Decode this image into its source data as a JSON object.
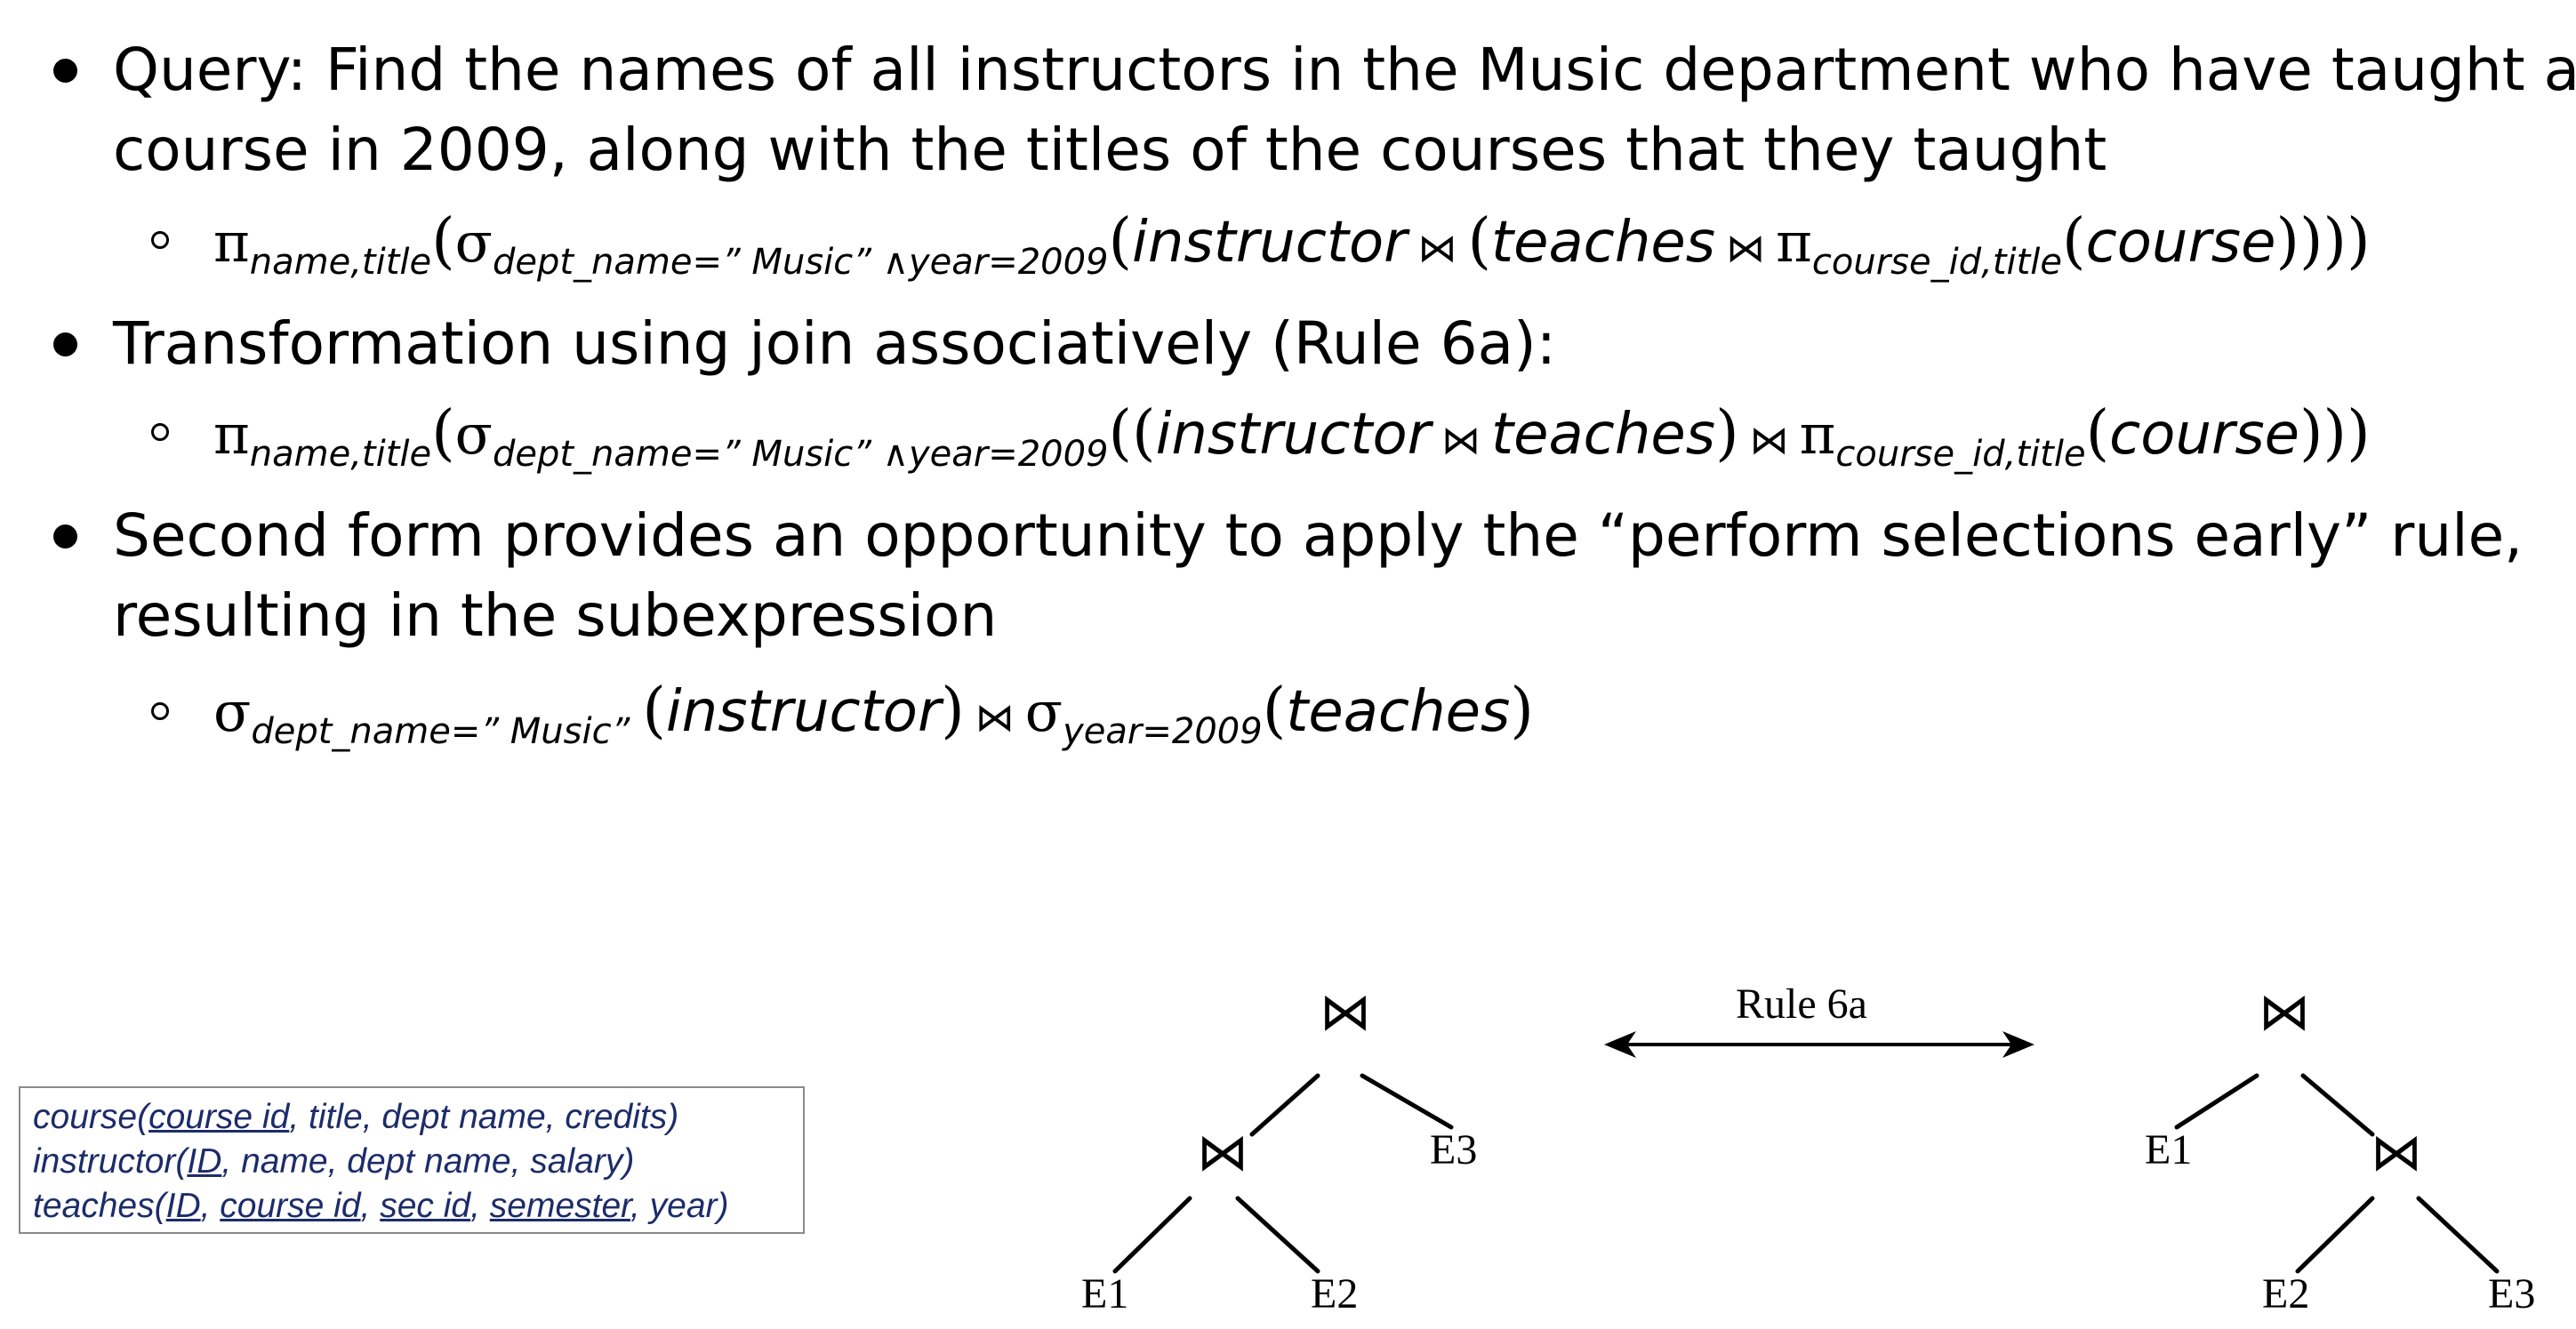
{
  "bullets": [
    {
      "lines": [
        "Query: Find the names of all instructors in the Music department who have taught a",
        "course in 2009, along with the titles of the courses that they taught"
      ]
    },
    {
      "lines": [
        "Transformation using join associatively (Rule 6a):"
      ]
    },
    {
      "lines": [
        "Second form provides an opportunity to apply the “perform selections early” rule,",
        "resulting in the subexpression"
      ]
    }
  ],
  "formulas": {
    "f1": {
      "pi": "π",
      "pi_sub": "name,title",
      "sigma": "σ",
      "sigma_sub": "dept_name=” Music” ∧year=2009",
      "rel_instructor": "instructor",
      "join": "⋈",
      "rel_teaches": "teaches",
      "pi2": "π",
      "pi2_sub": "course_id,title",
      "rel_course": "course"
    },
    "f2": {
      "pi": "π",
      "pi_sub": "name,title",
      "sigma": "σ",
      "sigma_sub": "dept_name=” Music” ∧year=2009",
      "rel_instructor": "instructor",
      "join": "⋈",
      "rel_teaches": "teaches",
      "pi2": "π",
      "pi2_sub": "course_id,title",
      "rel_course": "course"
    },
    "f3": {
      "sigma": "σ",
      "sigma_sub": "dept_name=” Music”",
      "rel_instructor": "instructor",
      "join": "⋈",
      "sigma2": "σ",
      "sigma2_sub": "year=2009",
      "rel_teaches": "teaches"
    }
  },
  "schema": {
    "course": {
      "name": "course",
      "attrs": [
        {
          "text": "course id",
          "key": true
        },
        {
          "text": "title",
          "key": false
        },
        {
          "text": "dept name",
          "key": false
        },
        {
          "text": "credits",
          "key": false
        }
      ]
    },
    "instructor": {
      "name": "instructor",
      "attrs": [
        {
          "text": "ID",
          "key": true
        },
        {
          "text": "name",
          "key": false
        },
        {
          "text": "dept name",
          "key": false
        },
        {
          "text": "salary",
          "key": false
        }
      ]
    },
    "teaches": {
      "name": "teaches",
      "attrs": [
        {
          "text": "ID",
          "key": true
        },
        {
          "text": "course id",
          "key": true
        },
        {
          "text": "sec id",
          "key": true
        },
        {
          "text": "semester",
          "key": true
        },
        {
          "text": "year",
          "key": false
        }
      ]
    }
  },
  "diagram": {
    "arrow_label": "Rule 6a",
    "join_symbol": "⋈",
    "left_tree": {
      "leaf1": "E1",
      "leaf2": "E2",
      "leaf3": "E3"
    },
    "right_tree": {
      "leaf1": "E1",
      "leaf2": "E2",
      "leaf3": "E3"
    }
  }
}
